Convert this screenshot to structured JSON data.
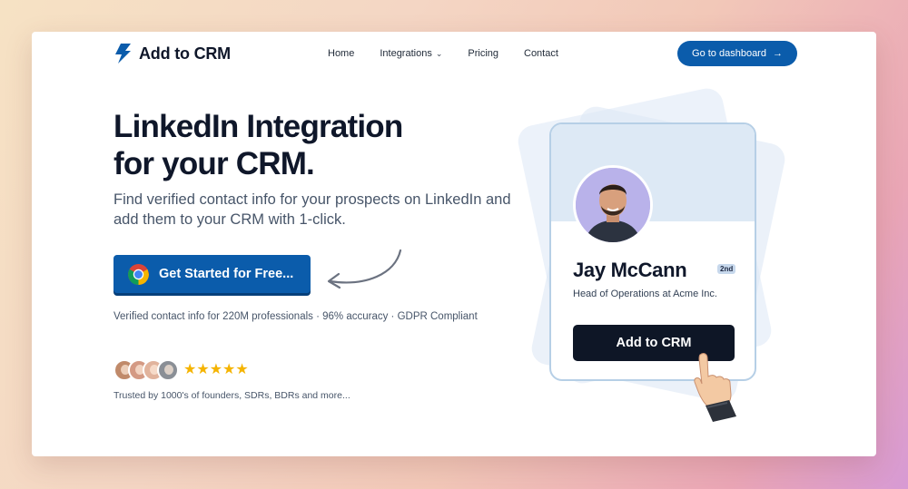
{
  "brand": {
    "name": "Add to CRM",
    "icon": "lightning-icon",
    "color": "#0b5cab"
  },
  "nav": {
    "links": [
      {
        "label": "Home"
      },
      {
        "label": "Integrations",
        "has_dropdown": true
      },
      {
        "label": "Pricing"
      },
      {
        "label": "Contact"
      }
    ],
    "dashboard_button": "Go to dashboard"
  },
  "hero": {
    "title_line1": "LinkedIn Integration",
    "title_line2": "for your CRM.",
    "subtitle": "Find verified contact info for your prospects on LinkedIn and add them to your CRM with 1-click.",
    "cta_label": "Get Started for Free...",
    "cta_icon": "chrome-icon",
    "stats": "Verified contact info for 220M professionals · 96% accuracy · GDPR Compliant",
    "rating": "★★★★★",
    "trusted": "Trusted by 1000's of founders, SDRs, BDRs and more..."
  },
  "profile_card": {
    "name": "Jay McCann",
    "degree": "2nd",
    "role": "Head of Operations at Acme Inc.",
    "button": "Add to CRM"
  },
  "colors": {
    "primary": "#0b5cab",
    "dark_button": "#0e1626",
    "star": "#f5b400"
  }
}
